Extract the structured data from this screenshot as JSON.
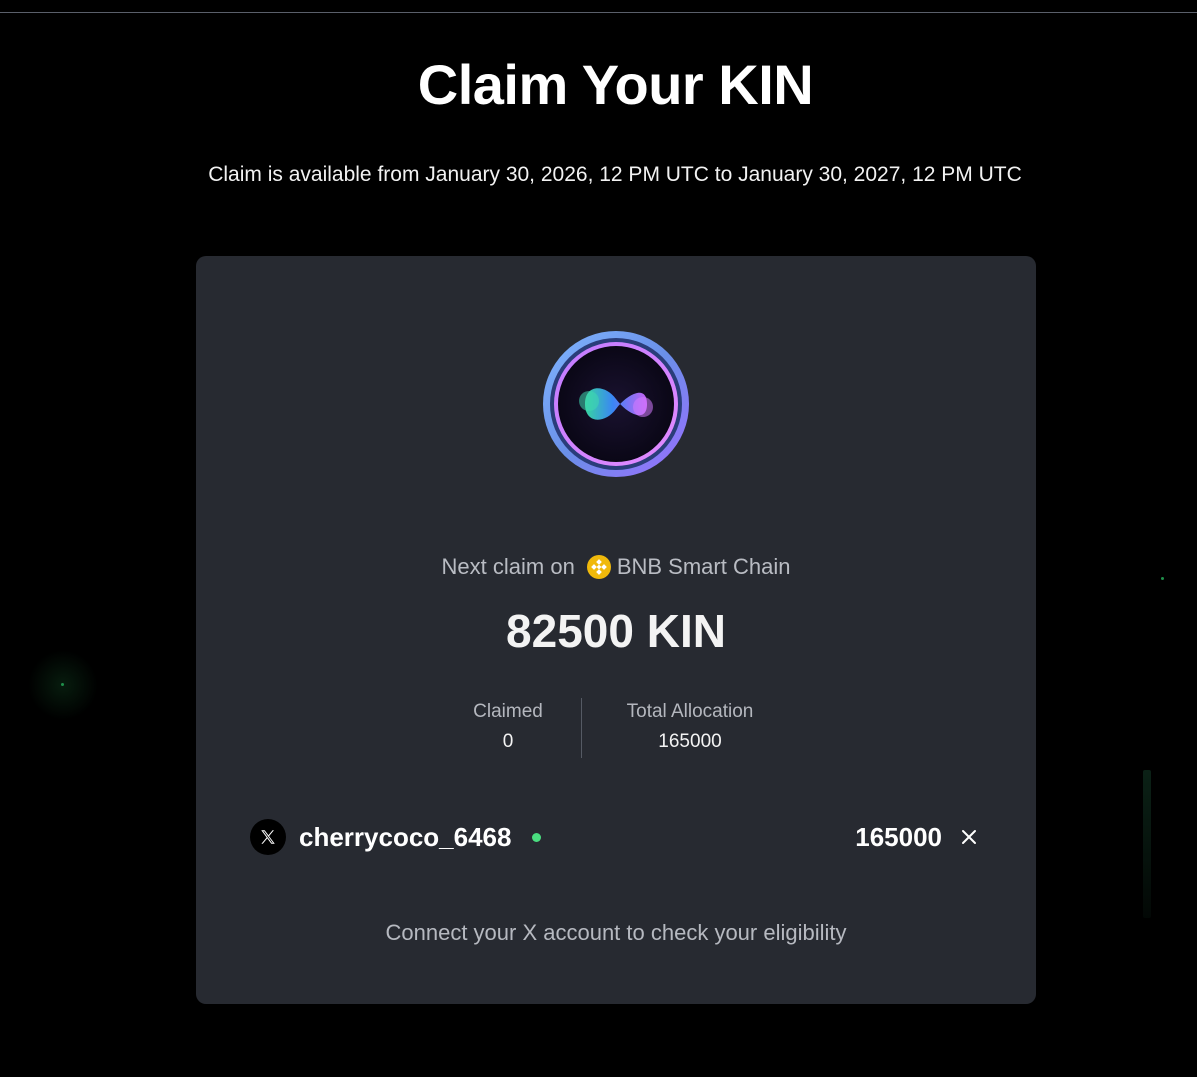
{
  "header": {
    "title": "Claim Your KIN",
    "subtitle": "Claim is available from January 30, 2026, 12 PM UTC to January 30, 2027, 12 PM UTC"
  },
  "card": {
    "logo_icon": "infinity-token-logo-icon",
    "next_claim_label": "Next claim on",
    "chain_icon": "bnb-chain-icon",
    "chain_name": "BNB Smart Chain",
    "next_claim_amount": "82500 KIN",
    "stats": {
      "claimed_label": "Claimed",
      "claimed_value": "0",
      "total_label": "Total Allocation",
      "total_value": "165000"
    },
    "account": {
      "platform_icon": "x-logo-icon",
      "username": "cherrycoco_6468",
      "status": "connected",
      "status_color": "#4ade80",
      "amount": "165000",
      "remove_icon": "close-icon"
    },
    "connect_prompt": "Connect your X account to check your eligibility"
  },
  "colors": {
    "background": "#000000",
    "card": "#272a31",
    "accent_bnb": "#f0b90b"
  }
}
